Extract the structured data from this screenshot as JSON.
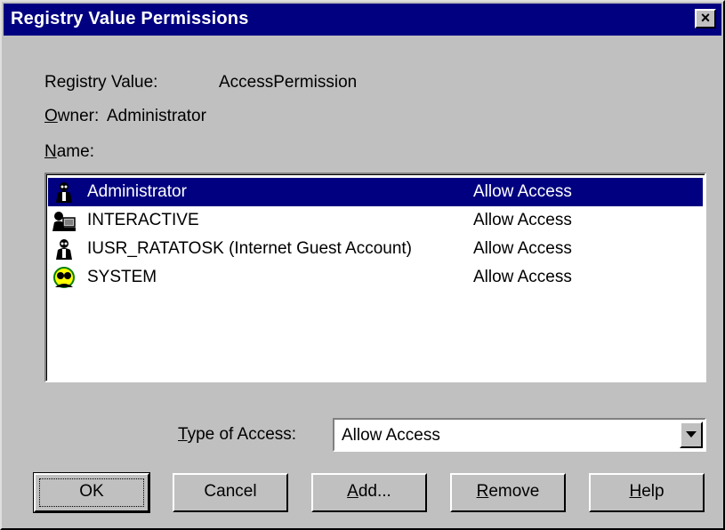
{
  "window": {
    "title": "Registry Value Permissions",
    "close_glyph": "×"
  },
  "info": {
    "registry_value_label": "Registry Value:",
    "registry_value": "AccessPermission",
    "owner_label_mnemonic": "O",
    "owner_label_rest": "wner:",
    "owner_value": "Administrator",
    "name_label_mnemonic": "N",
    "name_label_rest": "ame:"
  },
  "accounts": [
    {
      "name": "Administrator",
      "access": "Allow Access",
      "icon": "user-icon",
      "selected": true
    },
    {
      "name": "INTERACTIVE",
      "access": "Allow Access",
      "icon": "interactive-group-icon",
      "selected": false
    },
    {
      "name": "IUSR_RATATOSK (Internet Guest Account)",
      "access": "Allow Access",
      "icon": "user-icon",
      "selected": false
    },
    {
      "name": "SYSTEM",
      "access": "Allow Access",
      "icon": "system-group-icon",
      "selected": false
    }
  ],
  "type_of_access": {
    "label_mnemonic": "T",
    "label_rest": "ype of Access:",
    "value": "Allow Access"
  },
  "buttons": {
    "ok": "OK",
    "cancel": "Cancel",
    "add_mnemonic": "A",
    "add_rest": "dd...",
    "remove_mnemonic": "R",
    "remove_rest": "emove",
    "help_mnemonic": "H",
    "help_rest": "elp"
  },
  "colors": {
    "titlebar": "#000080",
    "face": "#c0c0c0",
    "selection": "#000080"
  }
}
